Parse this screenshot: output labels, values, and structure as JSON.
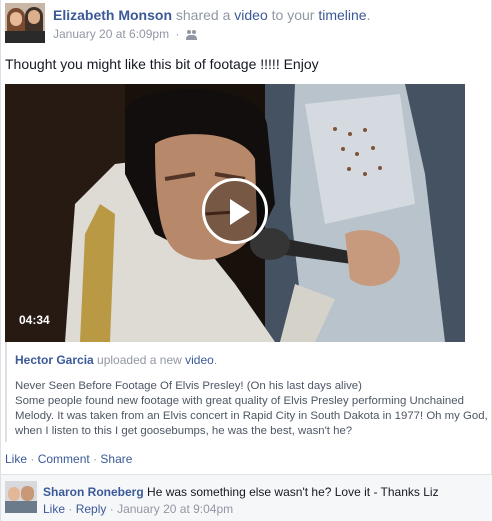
{
  "post": {
    "author": "Elizabeth Monson",
    "action_text_1": "shared a",
    "video_link": "video",
    "action_text_2": "to your",
    "timeline_link": "timeline",
    "period": ".",
    "timestamp": "January 20 at 6:09pm",
    "meta_separator": "·",
    "privacy_icon": "friends-icon",
    "status_text": "Thought you might like this bit of footage !!!!! Enjoy"
  },
  "video": {
    "duration": "04:34",
    "play_icon": "play-icon"
  },
  "attachment": {
    "author": "Hector Garcia",
    "action_text": "uploaded a new",
    "video_link": "video",
    "period": ".",
    "title": "Never Seen Before Footage Of Elvis Presley! (On his last days alive)",
    "description": "Some people found new footage with great quality of Elvis Presley performing Unchained Melody. It was taken from an Elvis concert in Rapid City in South Dakota in 1977! Oh my God, when I listen to this I get goosebumps, he was the best, wasn't he?"
  },
  "actions": {
    "like": "Like",
    "comment": "Comment",
    "share": "Share",
    "separator": "·"
  },
  "comment": {
    "author": "Sharon Roneberg",
    "text": "He was something else wasn't he? Love it - Thanks Liz",
    "like": "Like",
    "reply": "Reply",
    "separator": "·",
    "timestamp": "January 20 at 9:04pm"
  },
  "colors": {
    "link": "#3b5998",
    "meta": "#9197a3",
    "text": "#141823",
    "comment_bg": "#f6f7f9"
  }
}
